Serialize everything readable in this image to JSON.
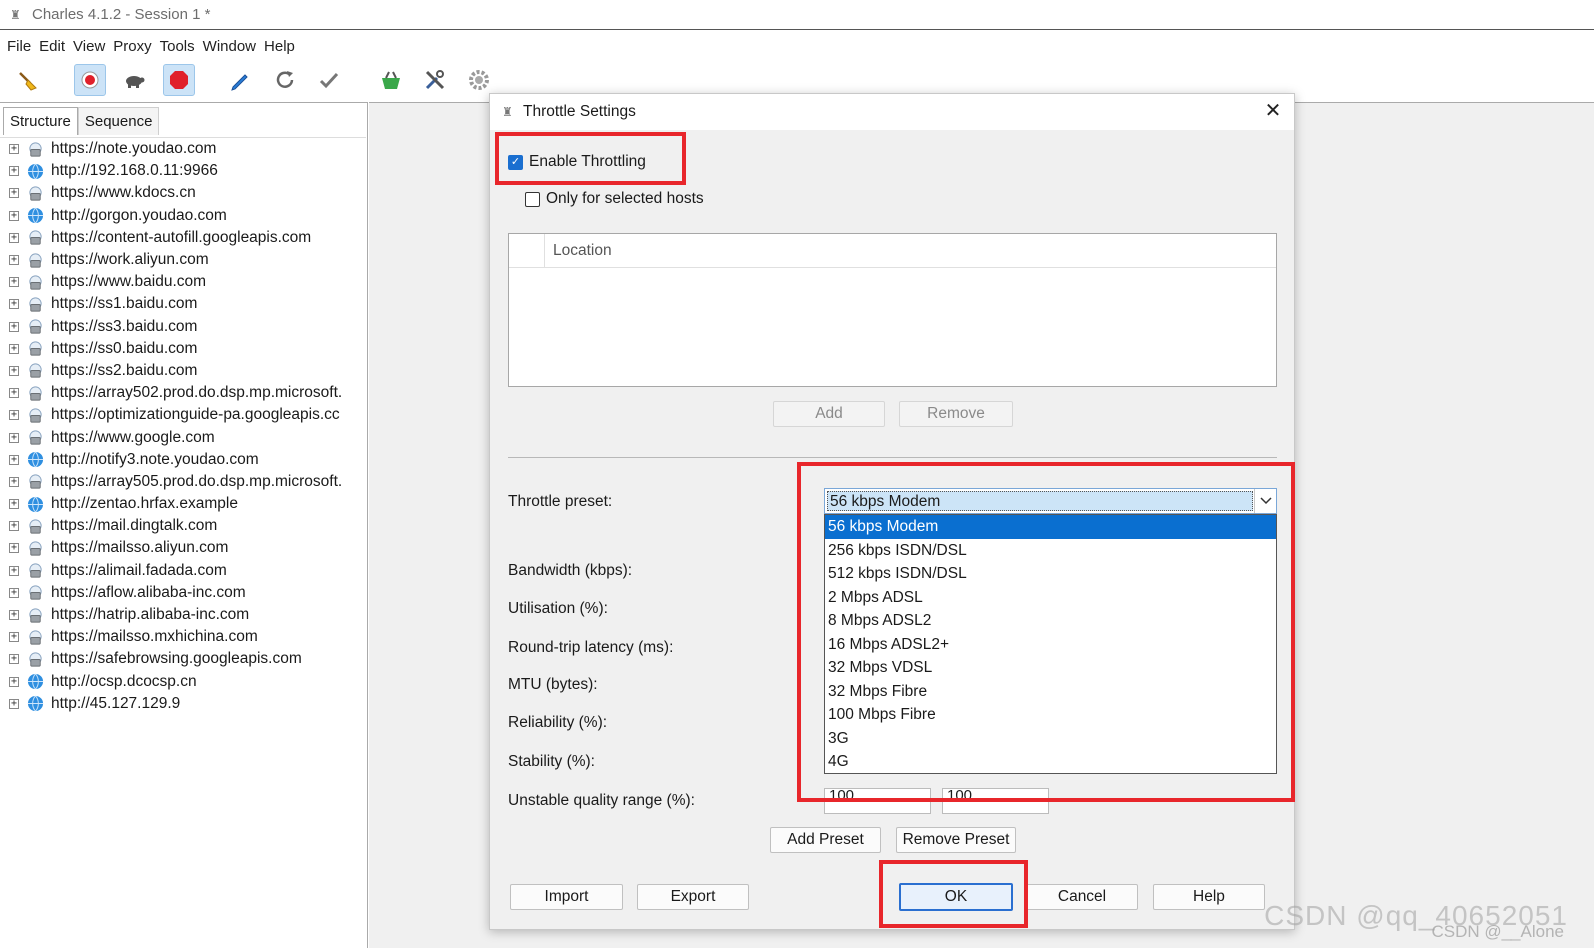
{
  "window": {
    "title": "Charles 4.1.2 - Session 1 *"
  },
  "menu": [
    "File",
    "Edit",
    "View",
    "Proxy",
    "Tools",
    "Window",
    "Help"
  ],
  "toolbar": {
    "icons": [
      "broom-icon",
      "record-icon",
      "throttle-turtle-icon",
      "breakpoint-stop-icon",
      "compose-pen-icon",
      "repeat-icon",
      "validate-check-icon",
      "basket-icon",
      "tools-icon",
      "settings-gear-icon"
    ]
  },
  "structure": {
    "tabs": [
      "Structure",
      "Sequence"
    ],
    "hosts": [
      "https://note.youdao.com",
      "http://192.168.0.11:9966",
      "https://www.kdocs.cn",
      "http://gorgon.youdao.com",
      "https://content-autofill.googleapis.com",
      "https://work.aliyun.com",
      "https://www.baidu.com",
      "https://ss1.baidu.com",
      "https://ss3.baidu.com",
      "https://ss0.baidu.com",
      "https://ss2.baidu.com",
      "https://array502.prod.do.dsp.mp.microsoft.",
      "https://optimizationguide-pa.googleapis.cc",
      "https://www.google.com",
      "http://notify3.note.youdao.com",
      "https://array505.prod.do.dsp.mp.microsoft.",
      "http://zentao.hrfax.example",
      "https://mail.dingtalk.com",
      "https://mailsso.aliyun.com",
      "https://alimail.fadada.com",
      "https://aflow.alibaba-inc.com",
      "https://hatrip.alibaba-inc.com",
      "https://mailsso.mxhichina.com",
      "https://safebrowsing.googleapis.com",
      "http://ocsp.dcocsp.cn",
      "http://45.127.129.9"
    ]
  },
  "dialog": {
    "title": "Throttle Settings",
    "close_label": "✕",
    "enable_throttling": {
      "label": "Enable Throttling",
      "checked": true
    },
    "only_selected_hosts": {
      "label": "Only for selected hosts",
      "checked": false
    },
    "location_header": "Location",
    "add_label": "Add",
    "remove_label": "Remove",
    "fields": {
      "throttle_preset": "Throttle preset:",
      "bandwidth": "Bandwidth (kbps):",
      "utilisation": "Utilisation (%):",
      "latency": "Round-trip latency (ms):",
      "mtu": "MTU (bytes):",
      "reliability": "Reliability (%):",
      "stability": "Stability (%):",
      "unstable_range": "Unstable quality range (%):"
    },
    "preset_selected": "56 kbps Modem",
    "preset_options": [
      "56 kbps Modem",
      "256 kbps ISDN/DSL",
      "512 kbps ISDN/DSL",
      "2 Mbps ADSL",
      "8 Mbps ADSL2",
      "16 Mbps ADSL2+",
      "32 Mbps VDSL",
      "32 Mbps Fibre",
      "100 Mbps Fibre",
      "3G",
      "4G"
    ],
    "unstable_range_values": [
      "100",
      "100"
    ],
    "add_preset_label": "Add Preset",
    "remove_preset_label": "Remove Preset",
    "import_label": "Import",
    "export_label": "Export",
    "ok_label": "OK",
    "cancel_label": "Cancel",
    "help_label": "Help"
  },
  "watermark": {
    "main": "CSDN @qq_40652051",
    "sub": "CSDN @__Alone"
  },
  "colors": {
    "highlight_box": "#e8262b",
    "selection": "#0a6fd0",
    "checkbox": "#1a6fd0"
  }
}
